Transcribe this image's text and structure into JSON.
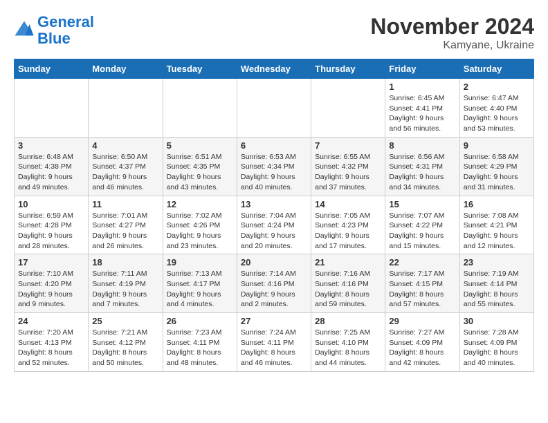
{
  "logo": {
    "line1": "General",
    "line2": "Blue"
  },
  "title": "November 2024",
  "location": "Kamyane, Ukraine",
  "weekdays": [
    "Sunday",
    "Monday",
    "Tuesday",
    "Wednesday",
    "Thursday",
    "Friday",
    "Saturday"
  ],
  "weeks": [
    [
      {
        "day": "",
        "info": ""
      },
      {
        "day": "",
        "info": ""
      },
      {
        "day": "",
        "info": ""
      },
      {
        "day": "",
        "info": ""
      },
      {
        "day": "",
        "info": ""
      },
      {
        "day": "1",
        "info": "Sunrise: 6:45 AM\nSunset: 4:41 PM\nDaylight: 9 hours and 56 minutes."
      },
      {
        "day": "2",
        "info": "Sunrise: 6:47 AM\nSunset: 4:40 PM\nDaylight: 9 hours and 53 minutes."
      }
    ],
    [
      {
        "day": "3",
        "info": "Sunrise: 6:48 AM\nSunset: 4:38 PM\nDaylight: 9 hours and 49 minutes."
      },
      {
        "day": "4",
        "info": "Sunrise: 6:50 AM\nSunset: 4:37 PM\nDaylight: 9 hours and 46 minutes."
      },
      {
        "day": "5",
        "info": "Sunrise: 6:51 AM\nSunset: 4:35 PM\nDaylight: 9 hours and 43 minutes."
      },
      {
        "day": "6",
        "info": "Sunrise: 6:53 AM\nSunset: 4:34 PM\nDaylight: 9 hours and 40 minutes."
      },
      {
        "day": "7",
        "info": "Sunrise: 6:55 AM\nSunset: 4:32 PM\nDaylight: 9 hours and 37 minutes."
      },
      {
        "day": "8",
        "info": "Sunrise: 6:56 AM\nSunset: 4:31 PM\nDaylight: 9 hours and 34 minutes."
      },
      {
        "day": "9",
        "info": "Sunrise: 6:58 AM\nSunset: 4:29 PM\nDaylight: 9 hours and 31 minutes."
      }
    ],
    [
      {
        "day": "10",
        "info": "Sunrise: 6:59 AM\nSunset: 4:28 PM\nDaylight: 9 hours and 28 minutes."
      },
      {
        "day": "11",
        "info": "Sunrise: 7:01 AM\nSunset: 4:27 PM\nDaylight: 9 hours and 26 minutes."
      },
      {
        "day": "12",
        "info": "Sunrise: 7:02 AM\nSunset: 4:26 PM\nDaylight: 9 hours and 23 minutes."
      },
      {
        "day": "13",
        "info": "Sunrise: 7:04 AM\nSunset: 4:24 PM\nDaylight: 9 hours and 20 minutes."
      },
      {
        "day": "14",
        "info": "Sunrise: 7:05 AM\nSunset: 4:23 PM\nDaylight: 9 hours and 17 minutes."
      },
      {
        "day": "15",
        "info": "Sunrise: 7:07 AM\nSunset: 4:22 PM\nDaylight: 9 hours and 15 minutes."
      },
      {
        "day": "16",
        "info": "Sunrise: 7:08 AM\nSunset: 4:21 PM\nDaylight: 9 hours and 12 minutes."
      }
    ],
    [
      {
        "day": "17",
        "info": "Sunrise: 7:10 AM\nSunset: 4:20 PM\nDaylight: 9 hours and 9 minutes."
      },
      {
        "day": "18",
        "info": "Sunrise: 7:11 AM\nSunset: 4:19 PM\nDaylight: 9 hours and 7 minutes."
      },
      {
        "day": "19",
        "info": "Sunrise: 7:13 AM\nSunset: 4:17 PM\nDaylight: 9 hours and 4 minutes."
      },
      {
        "day": "20",
        "info": "Sunrise: 7:14 AM\nSunset: 4:16 PM\nDaylight: 9 hours and 2 minutes."
      },
      {
        "day": "21",
        "info": "Sunrise: 7:16 AM\nSunset: 4:16 PM\nDaylight: 8 hours and 59 minutes."
      },
      {
        "day": "22",
        "info": "Sunrise: 7:17 AM\nSunset: 4:15 PM\nDaylight: 8 hours and 57 minutes."
      },
      {
        "day": "23",
        "info": "Sunrise: 7:19 AM\nSunset: 4:14 PM\nDaylight: 8 hours and 55 minutes."
      }
    ],
    [
      {
        "day": "24",
        "info": "Sunrise: 7:20 AM\nSunset: 4:13 PM\nDaylight: 8 hours and 52 minutes."
      },
      {
        "day": "25",
        "info": "Sunrise: 7:21 AM\nSunset: 4:12 PM\nDaylight: 8 hours and 50 minutes."
      },
      {
        "day": "26",
        "info": "Sunrise: 7:23 AM\nSunset: 4:11 PM\nDaylight: 8 hours and 48 minutes."
      },
      {
        "day": "27",
        "info": "Sunrise: 7:24 AM\nSunset: 4:11 PM\nDaylight: 8 hours and 46 minutes."
      },
      {
        "day": "28",
        "info": "Sunrise: 7:25 AM\nSunset: 4:10 PM\nDaylight: 8 hours and 44 minutes."
      },
      {
        "day": "29",
        "info": "Sunrise: 7:27 AM\nSunset: 4:09 PM\nDaylight: 8 hours and 42 minutes."
      },
      {
        "day": "30",
        "info": "Sunrise: 7:28 AM\nSunset: 4:09 PM\nDaylight: 8 hours and 40 minutes."
      }
    ]
  ]
}
